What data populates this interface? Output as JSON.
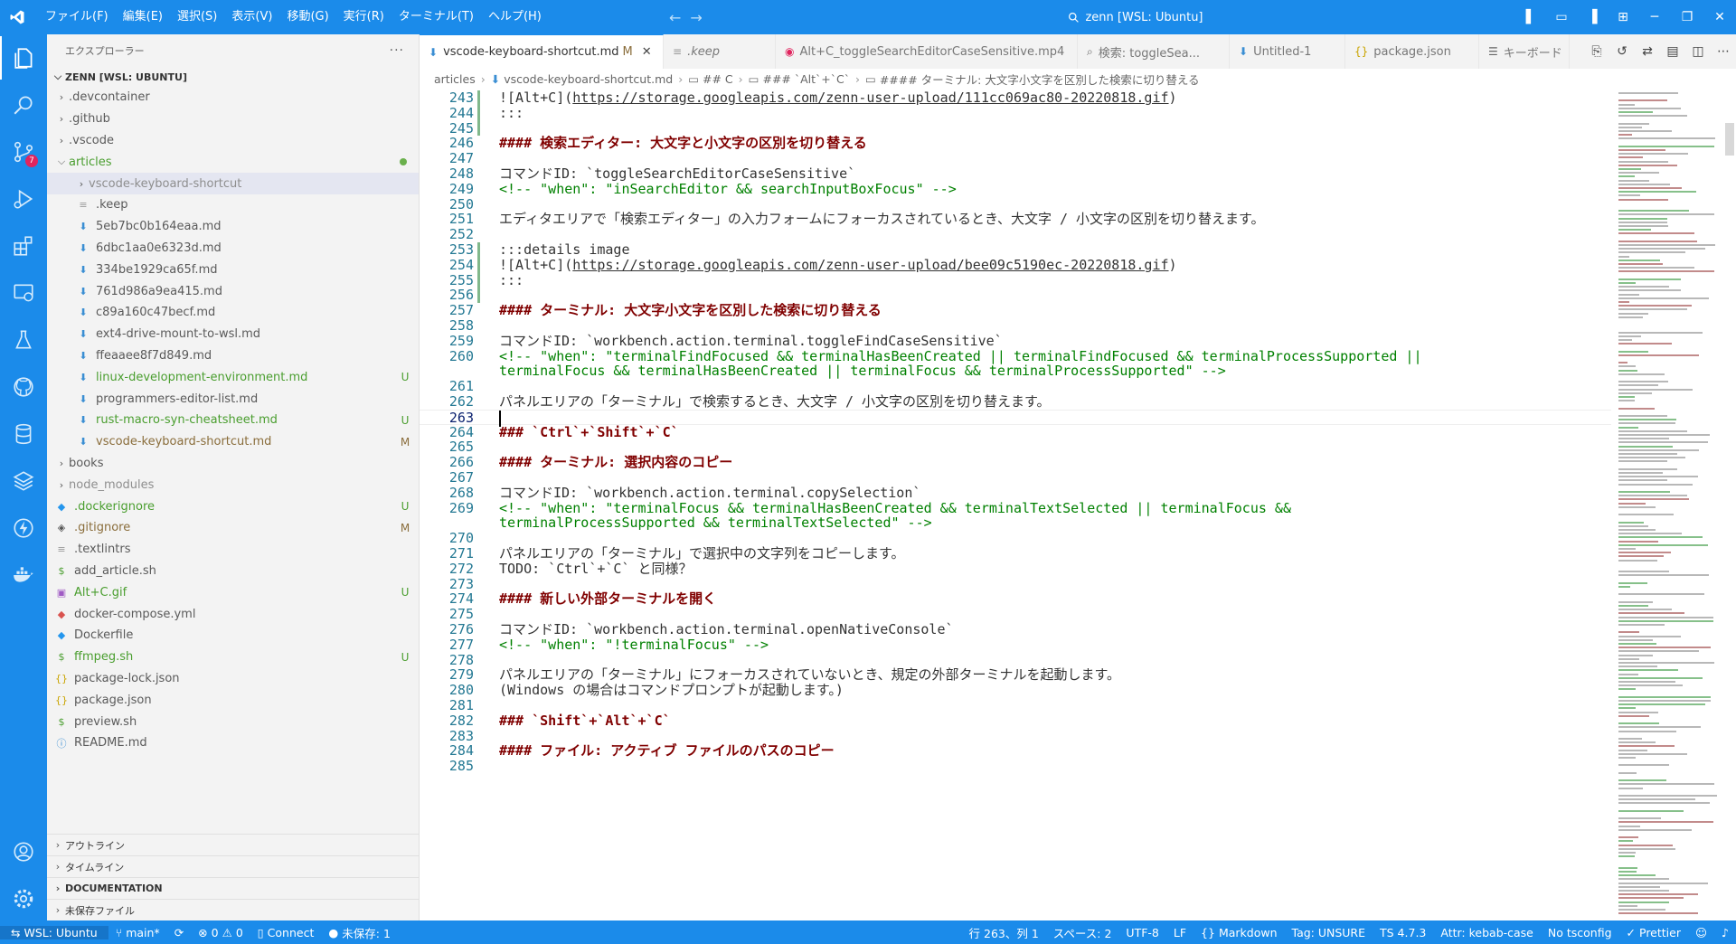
{
  "titlebar": {
    "menus": [
      "ファイル(F)",
      "編集(E)",
      "選択(S)",
      "表示(V)",
      "移動(G)",
      "実行(R)",
      "ターミナル(T)",
      "ヘルプ(H)"
    ],
    "search_text": "zenn [WSL: Ubuntu]"
  },
  "activitybar": {
    "scm_badge": "7"
  },
  "sidebar": {
    "title": "エクスプローラー",
    "more": "···",
    "workspace": "ZENN [WSL: UBUNTU]",
    "tree": [
      {
        "name": ".devcontainer",
        "type": "folder"
      },
      {
        "name": ".github",
        "type": "folder"
      },
      {
        "name": ".vscode",
        "type": "folder"
      },
      {
        "name": "articles",
        "type": "folder-open"
      },
      {
        "name": "vscode-keyboard-shortcut",
        "type": "subfolder"
      },
      {
        "name": ".keep",
        "type": "file"
      },
      {
        "name": "5eb7bc0b164eaa.md",
        "type": "md"
      },
      {
        "name": "6dbc1aa0e6323d.md",
        "type": "md"
      },
      {
        "name": "334be1929ca65f.md",
        "type": "md"
      },
      {
        "name": "761d986a9ea415.md",
        "type": "md"
      },
      {
        "name": "c89a160c47becf.md",
        "type": "md"
      },
      {
        "name": "ext4-drive-mount-to-wsl.md",
        "type": "md"
      },
      {
        "name": "ffeaaee8f7d849.md",
        "type": "md"
      },
      {
        "name": "linux-development-environment.md",
        "type": "md",
        "status": "U"
      },
      {
        "name": "programmers-editor-list.md",
        "type": "md"
      },
      {
        "name": "rust-macro-syn-cheatsheet.md",
        "type": "md",
        "status": "U"
      },
      {
        "name": "vscode-keyboard-shortcut.md",
        "type": "md",
        "status": "M"
      },
      {
        "name": "books",
        "type": "folder"
      },
      {
        "name": "node_modules",
        "type": "folder"
      },
      {
        "name": ".dockerignore",
        "type": "docker",
        "status": "U"
      },
      {
        "name": ".gitignore",
        "type": "git",
        "status": "M"
      },
      {
        "name": ".textlintrs",
        "type": "text"
      },
      {
        "name": "add_article.sh",
        "type": "sh"
      },
      {
        "name": "Alt+C.gif",
        "type": "gif",
        "status": "U"
      },
      {
        "name": "docker-compose.yml",
        "type": "compose"
      },
      {
        "name": "Dockerfile",
        "type": "docker"
      },
      {
        "name": "ffmpeg.sh",
        "type": "sh",
        "status": "U"
      },
      {
        "name": "package-lock.json",
        "type": "json"
      },
      {
        "name": "package.json",
        "type": "json"
      },
      {
        "name": "preview.sh",
        "type": "sh"
      },
      {
        "name": "README.md",
        "type": "info"
      }
    ],
    "sections": [
      "アウトライン",
      "タイムライン",
      "DOCUMENTATION",
      "未保存ファイル"
    ]
  },
  "tabs": [
    {
      "label": "vscode-keyboard-shortcut.md",
      "status": "M",
      "active": true
    },
    {
      "label": ".keep"
    },
    {
      "label": "Alt+C_toggleSearchEditorCaseSensitive.mp4"
    },
    {
      "label": "検索: toggleSea..."
    },
    {
      "label": "Untitled-1"
    },
    {
      "label": "package.json"
    },
    {
      "label": "キーボード"
    }
  ],
  "breadcrumb": [
    "articles",
    "vscode-keyboard-shortcut.md",
    "## C",
    "### `Alt`+`C`",
    "#### ターミナル: 大文字小文字を区別した検索に切り替える"
  ],
  "editor": {
    "current_line": 263,
    "lines": [
      {
        "n": "243",
        "t": "link",
        "a": "![Alt+C](",
        "b": "https://storage.googleapis.com/zenn-user-upload/111cc069ac80-20220818.gif",
        "c": ")"
      },
      {
        "n": "244",
        "t": "plain",
        "text": ":::"
      },
      {
        "n": "245",
        "t": "plain",
        "text": ""
      },
      {
        "n": "246",
        "t": "heading",
        "text": "#### 検索エディター: 大文字と小文字の区別を切り替える"
      },
      {
        "n": "247",
        "t": "plain",
        "text": ""
      },
      {
        "n": "248",
        "t": "plain",
        "text": "コマンドID: `toggleSearchEditorCaseSensitive`"
      },
      {
        "n": "249",
        "t": "comment",
        "text": "<!-- \"when\": \"inSearchEditor && searchInputBoxFocus\" -->"
      },
      {
        "n": "250",
        "t": "plain",
        "text": ""
      },
      {
        "n": "251",
        "t": "plain",
        "text": "エディタエリアで「検索エディター」の入力フォームにフォーカスされているとき、大文字 / 小文字の区別を切り替えます。"
      },
      {
        "n": "252",
        "t": "plain",
        "text": ""
      },
      {
        "n": "253",
        "t": "plain",
        "text": ":::details image"
      },
      {
        "n": "254",
        "t": "link",
        "a": "![Alt+C](",
        "b": "https://storage.googleapis.com/zenn-user-upload/bee09c5190ec-20220818.gif",
        "c": ")"
      },
      {
        "n": "255",
        "t": "plain",
        "text": ":::"
      },
      {
        "n": "256",
        "t": "plain",
        "text": ""
      },
      {
        "n": "257",
        "t": "heading",
        "text": "#### ターミナル: 大文字小文字を区別した検索に切り替える"
      },
      {
        "n": "258",
        "t": "plain",
        "text": ""
      },
      {
        "n": "259",
        "t": "plain",
        "text": "コマンドID: `workbench.action.terminal.toggleFindCaseSensitive`"
      },
      {
        "n": "260",
        "t": "comment",
        "text": "<!-- \"when\": \"terminalFindFocused && terminalHasBeenCreated || terminalFindFocused && terminalProcessSupported ||"
      },
      {
        "n": "",
        "t": "comment",
        "text": "terminalFocus && terminalHasBeenCreated || terminalFocus && terminalProcessSupported\" -->"
      },
      {
        "n": "261",
        "t": "plain",
        "text": ""
      },
      {
        "n": "262",
        "t": "plain",
        "text": "パネルエリアの「ターミナル」で検索するとき、大文字 / 小文字の区別を切り替えます。"
      },
      {
        "n": "263",
        "t": "cursor",
        "text": ""
      },
      {
        "n": "264",
        "t": "heading",
        "text": "### `Ctrl`+`Shift`+`C`"
      },
      {
        "n": "265",
        "t": "plain",
        "text": ""
      },
      {
        "n": "266",
        "t": "heading",
        "text": "#### ターミナル: 選択内容のコピー"
      },
      {
        "n": "267",
        "t": "plain",
        "text": ""
      },
      {
        "n": "268",
        "t": "plain",
        "text": "コマンドID: `workbench.action.terminal.copySelection`"
      },
      {
        "n": "269",
        "t": "comment",
        "text": "<!-- \"when\": \"terminalFocus && terminalHasBeenCreated && terminalTextSelected || terminalFocus &&"
      },
      {
        "n": "",
        "t": "comment",
        "text": "terminalProcessSupported && terminalTextSelected\" -->"
      },
      {
        "n": "270",
        "t": "plain",
        "text": ""
      },
      {
        "n": "271",
        "t": "plain",
        "text": "パネルエリアの「ターミナル」で選択中の文字列をコピーします。"
      },
      {
        "n": "272",
        "t": "plain",
        "text": "TODO: `Ctrl`+`C` と同様？"
      },
      {
        "n": "273",
        "t": "plain",
        "text": ""
      },
      {
        "n": "274",
        "t": "heading",
        "text": "#### 新しい外部ターミナルを開く"
      },
      {
        "n": "275",
        "t": "plain",
        "text": ""
      },
      {
        "n": "276",
        "t": "plain",
        "text": "コマンドID: `workbench.action.terminal.openNativeConsole`"
      },
      {
        "n": "277",
        "t": "comment",
        "text": "<!-- \"when\": \"!terminalFocus\" -->"
      },
      {
        "n": "278",
        "t": "plain",
        "text": ""
      },
      {
        "n": "279",
        "t": "plain",
        "text": "パネルエリアの「ターミナル」にフォーカスされていないとき、規定の外部ターミナルを起動します。"
      },
      {
        "n": "280",
        "t": "plain",
        "text": "(Windows の場合はコマンドプロンプトが起動します。)"
      },
      {
        "n": "281",
        "t": "plain",
        "text": ""
      },
      {
        "n": "282",
        "t": "heading",
        "text": "### `Shift`+`Alt`+`C`"
      },
      {
        "n": "283",
        "t": "plain",
        "text": ""
      },
      {
        "n": "284",
        "t": "heading",
        "text": "#### ファイル: アクティブ ファイルのパスのコピー"
      },
      {
        "n": "285",
        "t": "plain",
        "text": ""
      }
    ]
  },
  "statusbar": {
    "remote": "WSL: Ubuntu",
    "branch": "main*",
    "errors": "0",
    "warnings": "0",
    "connect": "Connect",
    "unsaved": "未保存: 1",
    "position": "行 263、列 1",
    "spaces": "スペース: 2",
    "encoding": "UTF-8",
    "eol": "LF",
    "language": "Markdown",
    "tag": "Tag: UNSURE",
    "ts_version": "TS 4.7.3",
    "attr": "Attr: kebab-case",
    "tsconfig": "No tsconfig",
    "prettier": "Prettier"
  },
  "colors": {
    "accent": "#1b8bea",
    "heading": "#800000",
    "comment": "#008000",
    "untracked": "#4a9e2f",
    "modified": "#8a6d3b"
  }
}
